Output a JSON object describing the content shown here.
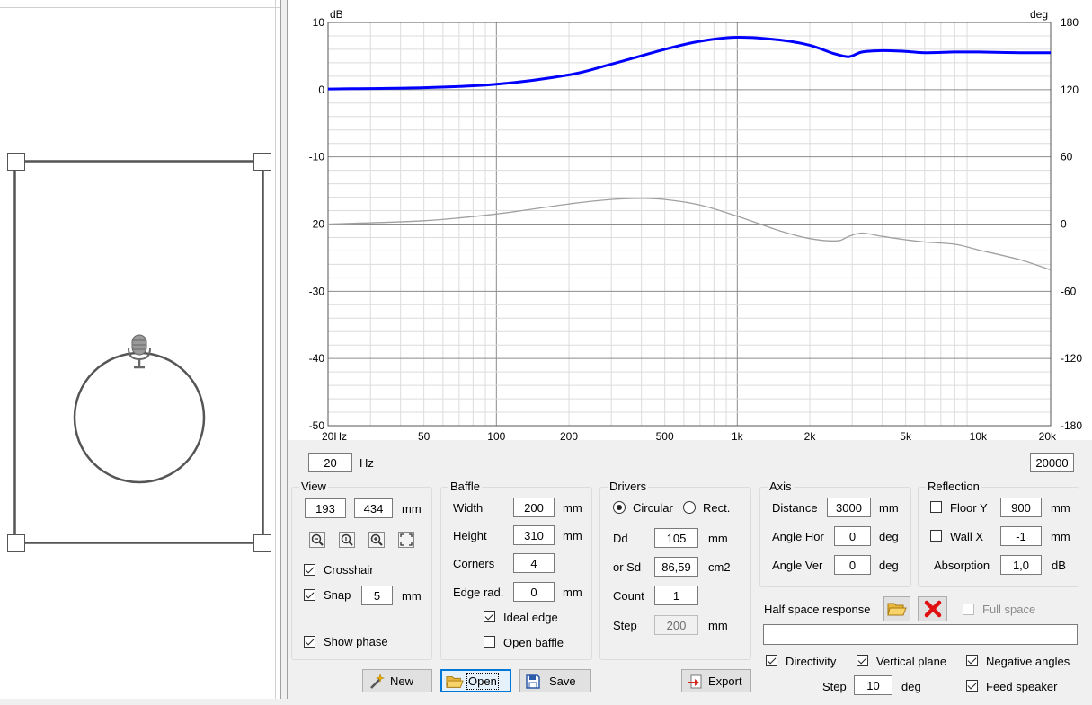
{
  "chart_data": {
    "type": "line",
    "x_scale": "log",
    "xlim": [
      20,
      20000
    ],
    "ylim": [
      -50,
      10
    ],
    "y2lim": [
      -180,
      180
    ],
    "ylabel": "dB",
    "y2label": "deg",
    "x_ticks": [
      "20Hz",
      "50",
      "100",
      "200",
      "500",
      "1k",
      "2k",
      "5k",
      "10k",
      "20k"
    ],
    "y_ticks": [
      "10",
      "0",
      "-10",
      "-20",
      "-30",
      "-40",
      "-50"
    ],
    "y2_ticks": [
      "180",
      "120",
      "60",
      "0",
      "-60",
      "-120",
      "-180"
    ],
    "grid": true,
    "series": [
      {
        "axis": "left",
        "color": "#0000ff",
        "points": [
          [
            20,
            0.1
          ],
          [
            50,
            0.3
          ],
          [
            100,
            0.8
          ],
          [
            200,
            2.2
          ],
          [
            300,
            3.8
          ],
          [
            500,
            6.0
          ],
          [
            700,
            7.2
          ],
          [
            1000,
            7.8
          ],
          [
            1500,
            7.4
          ],
          [
            2000,
            6.6
          ],
          [
            2500,
            5.4
          ],
          [
            2900,
            4.9
          ],
          [
            3300,
            5.6
          ],
          [
            4000,
            5.8
          ],
          [
            5000,
            5.7
          ],
          [
            6000,
            5.5
          ],
          [
            8000,
            5.6
          ],
          [
            10000,
            5.6
          ],
          [
            15000,
            5.5
          ],
          [
            20000,
            5.5
          ]
        ]
      },
      {
        "axis": "right",
        "color": "#a0a0a0",
        "points": [
          [
            20,
            0
          ],
          [
            50,
            3
          ],
          [
            100,
            9
          ],
          [
            200,
            18
          ],
          [
            300,
            22
          ],
          [
            400,
            23
          ],
          [
            500,
            22
          ],
          [
            700,
            17
          ],
          [
            1000,
            7
          ],
          [
            1500,
            -6
          ],
          [
            2000,
            -13
          ],
          [
            2600,
            -15
          ],
          [
            2900,
            -11
          ],
          [
            3300,
            -8
          ],
          [
            4000,
            -11
          ],
          [
            5000,
            -14
          ],
          [
            6000,
            -16
          ],
          [
            8000,
            -18
          ],
          [
            10000,
            -23
          ],
          [
            15000,
            -32
          ],
          [
            20000,
            -41
          ]
        ]
      }
    ]
  },
  "freq_range": {
    "min": "20",
    "unit": "Hz",
    "max": "20000"
  },
  "view": {
    "title": "View",
    "width": "193",
    "height": "434",
    "unit": "mm",
    "crosshair": "Crosshair",
    "snap": "Snap",
    "snap_value": "5",
    "snap_unit": "mm",
    "show_phase": "Show phase"
  },
  "baffle": {
    "title": "Baffle",
    "width_label": "Width",
    "width": "200",
    "height_label": "Height",
    "height": "310",
    "corners_label": "Corners",
    "corners": "4",
    "edge_label": "Edge rad.",
    "edge": "0",
    "unit": "mm",
    "ideal_edge": "Ideal edge",
    "open_baffle": "Open baffle"
  },
  "drivers": {
    "title": "Drivers",
    "circular": "Circular",
    "rect": "Rect.",
    "dd_label": "Dd",
    "dd": "105",
    "dd_unit": "mm",
    "sd_label": "or Sd",
    "sd": "86,59",
    "sd_unit": "cm2",
    "count_label": "Count",
    "count": "1",
    "step_label": "Step",
    "step": "200",
    "step_unit": "mm"
  },
  "axis": {
    "title": "Axis",
    "distance_label": "Distance",
    "distance": "3000",
    "distance_unit": "mm",
    "hor_label": "Angle Hor",
    "hor": "0",
    "ver_label": "Angle Ver",
    "ver": "0",
    "deg": "deg"
  },
  "reflection": {
    "title": "Reflection",
    "floor_label": "Floor Y",
    "floor": "900",
    "wall_label": "Wall  X",
    "wall": "-1",
    "unit": "mm",
    "absorption_label": "Absorption",
    "absorption": "1,0",
    "absorption_unit": "dB"
  },
  "half_space": {
    "label": "Half space response",
    "full_space": "Full space",
    "path": ""
  },
  "directivity": {
    "directivity": "Directivity",
    "vertical_plane": "Vertical plane",
    "negative_angles": "Negative angles",
    "step_label": "Step",
    "step": "10",
    "step_unit": "deg",
    "feed_speaker": "Feed speaker"
  },
  "buttons": {
    "new": "New",
    "open": "Open",
    "save": "Save",
    "export": "Export"
  }
}
